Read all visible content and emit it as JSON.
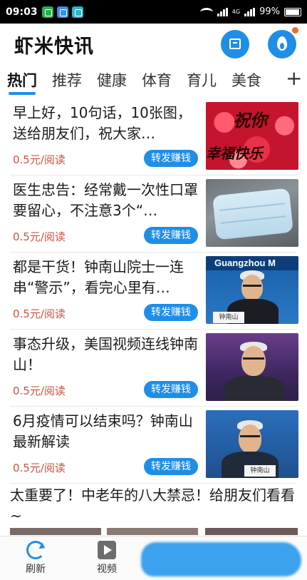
{
  "status_bar": {
    "time": "09:03",
    "battery": "99%",
    "network": "4G"
  },
  "header": {
    "title": "虾米快讯"
  },
  "tabs": [
    {
      "label": "热门"
    },
    {
      "label": "推荐"
    },
    {
      "label": "健康"
    },
    {
      "label": "体育"
    },
    {
      "label": "育儿"
    },
    {
      "label": "美食"
    }
  ],
  "tabs_plus": "+",
  "feed": [
    {
      "title": "早上好，10句话，10张图，送给朋友们，祝大家…",
      "price": "0.5元/阅读",
      "button": "转发赚钱",
      "thumb_text": [
        "祝你",
        "幸福快乐"
      ]
    },
    {
      "title": "医生忠告：经常戴一次性口罩要留心，不注意3个“…",
      "price": "0.5元/阅读",
      "button": "转发赚钱"
    },
    {
      "title": "都是干货！钟南山院士一连串“警示”，看完心里有…",
      "price": "0.5元/阅读",
      "button": "转发赚钱",
      "thumb_text": [
        "Guangzhou M",
        "钟南山"
      ]
    },
    {
      "title": "事态升级，美国视频连线钟南山！",
      "price": "0.5元/阅读",
      "button": "转发赚钱"
    },
    {
      "title": "6月疫情可以结束吗？钟南山最新解读",
      "price": "0.5元/阅读",
      "button": "转发赚钱",
      "thumb_text": [
        "钟南山"
      ]
    }
  ],
  "last_item": {
    "title": "太重要了！中老年的八大禁忌！给朋友们看看~"
  },
  "bottom_nav": [
    {
      "label": "刷新",
      "icon": "refresh-icon"
    },
    {
      "label": "视频",
      "icon": "video-icon"
    }
  ],
  "colors": {
    "accent": "#1e8ee8",
    "price": "#c9543e",
    "badge": "#f26a2a"
  }
}
